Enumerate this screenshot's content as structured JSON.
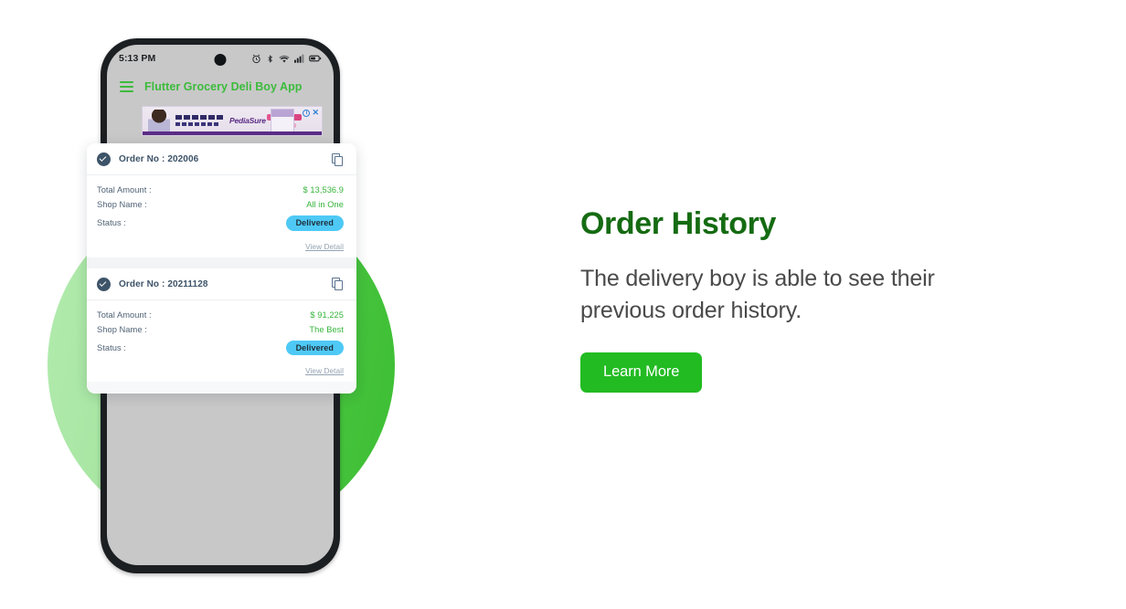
{
  "colors": {
    "brand_green": "#22bb22",
    "headline_green": "#156b12",
    "appbar_green": "#3cbb3c",
    "status_badge_blue": "#4ec9f5",
    "order_text_navy": "#3d5368",
    "value_green": "#35b43a",
    "phone_frame": "#1b1f22",
    "phone_screen": "#c8c8c8"
  },
  "phone": {
    "status_bar": {
      "time": "5:13 PM",
      "icons": [
        "alarm-icon",
        "bluetooth-icon",
        "wifi-icon",
        "signal-icon",
        "battery-icon"
      ]
    },
    "app_bar": {
      "menu_icon": "hamburger-menu-icon",
      "title": "Flutter Grocery Deli Boy  App"
    },
    "ad_banner": {
      "brand": "PediaSure",
      "info_icon": "ad-info-icon",
      "close_icon": "ad-close-icon",
      "close_label": "✕",
      "info_label": "i"
    }
  },
  "orders": {
    "labels": {
      "total_amount": "Total Amount  :",
      "shop_name": "Shop Name :",
      "status": "Status :",
      "view_detail": "View Detail",
      "copy_icon": "copy-icon",
      "verified_icon": "verified-check-icon"
    },
    "items": [
      {
        "order_no": "Order No : 202006",
        "total_amount": "$ 13,536.9",
        "shop_name": "All in One",
        "status": "Delivered"
      },
      {
        "order_no": "Order No : 20211128",
        "total_amount": "$ 91,225",
        "shop_name": "The Best",
        "status": "Delivered"
      }
    ]
  },
  "feature": {
    "headline": "Order History",
    "description": "The delivery boy is able to see their previous order history.",
    "cta_label": "Learn More"
  }
}
